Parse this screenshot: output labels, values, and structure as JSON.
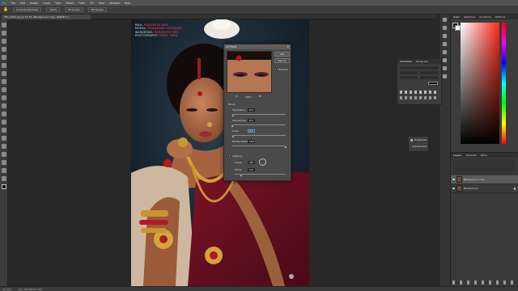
{
  "menubar": {
    "items": [
      "PS",
      "File",
      "Edit",
      "Image",
      "Layer",
      "Type",
      "Select",
      "Filter",
      "3D",
      "View",
      "Window",
      "Help"
    ]
  },
  "options": {
    "buttons": [
      "Scroll All Windows",
      "100%",
      "Fit Screen",
      "Fill Screen"
    ]
  },
  "document": {
    "tab_title": "IMG_5494.jpg @ 33.3% (Background copy, RGB/8*) ×"
  },
  "credits": {
    "lines": [
      {
        "role": "MUA",
        "name": "PAROMITA DEY"
      },
      {
        "role": "MODEL",
        "name": "PAMANINA GOSWAMI"
      },
      {
        "role": "WARDROBE",
        "name": "PAROMITA DEY"
      },
      {
        "role": "PHOTOGRAPHY",
        "name": "PIXEL TREE"
      }
    ]
  },
  "dialog": {
    "title": "Oil Paint",
    "close": "×",
    "ok": "OK",
    "cancel": "Cancel",
    "preview_label": "Preview",
    "zoom_out": "⊖",
    "zoom_level": "100%",
    "zoom_in": "⊕",
    "brush_section": "Brush",
    "params": [
      {
        "label": "Stylization:",
        "value": "0.3",
        "level": 0.03
      },
      {
        "label": "Cleanliness:",
        "value": "0.1",
        "level": 0.01
      },
      {
        "label": "Scale:",
        "value": "0.3",
        "level": 0.03
      },
      {
        "label": "Bristle Detail:",
        "value": "10.0",
        "level": 1.0
      }
    ],
    "lighting_label": "Lighting",
    "angle_label": "Angle:",
    "angle_value": "-60",
    "shine_label": "Shine:",
    "shine_value": "1.3",
    "shine_level": 0.13
  },
  "panels": {
    "color_tabs": [
      "Color",
      "Swatches",
      "Gradients",
      "Patterns"
    ],
    "character_tabs": [
      "Character",
      "Paragraph"
    ],
    "properties_items": [
      {
        "label": "Properties",
        "icon": "properties-icon"
      },
      {
        "label": "Adjustments",
        "icon": "adjustments-icon"
      }
    ],
    "layers_tabs": [
      "Layers",
      "Channels",
      "Paths"
    ],
    "layers": [
      {
        "name": "Background copy",
        "selected": true
      },
      {
        "name": "Background",
        "selected": false
      }
    ]
  },
  "status": {
    "zoom": "33.33%",
    "doc_info": "Doc: 68.5M/137.0M"
  },
  "colors": {
    "accent_red": "#b23a48",
    "panel_bg": "#3c3c3c",
    "canvas_bg": "#282828"
  }
}
